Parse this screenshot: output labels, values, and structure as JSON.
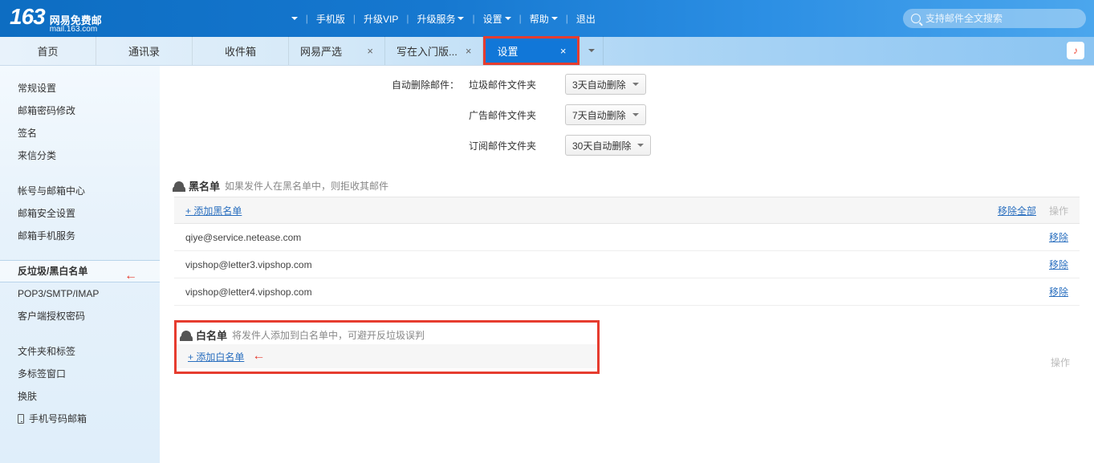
{
  "header": {
    "logo_num": "163",
    "logo_cn": "网易免费邮",
    "logo_en": "mail.163.com",
    "nav": {
      "mobile": "手机版",
      "upgrade_vip": "升级VIP",
      "upgrade_service": "升级服务",
      "settings": "设置",
      "help": "帮助",
      "logout": "退出"
    },
    "search_placeholder": "支持邮件全文搜索"
  },
  "tabs": {
    "home": "首页",
    "contacts": "通讯录",
    "inbox": "收件箱",
    "yanxuan": "网易严选",
    "compose": "写在入门版...",
    "settings": "设置"
  },
  "sidebar": {
    "group1": [
      "常规设置",
      "邮箱密码修改",
      "签名",
      "来信分类"
    ],
    "group2": [
      "帐号与邮箱中心",
      "邮箱安全设置",
      "邮箱手机服务"
    ],
    "active": "反垃圾/黑白名单",
    "group3": [
      "POP3/SMTP/IMAP",
      "客户端授权密码"
    ],
    "group4_item1": "文件夹和标签",
    "group4_item2": "多标签窗口",
    "group4_item3": "换肤",
    "group4_item4": "手机号码邮箱"
  },
  "content": {
    "auto_delete_label": "自动删除邮件：",
    "rows": [
      {
        "folder": "垃圾邮件文件夹",
        "value": "3天自动删除"
      },
      {
        "folder": "广告邮件文件夹",
        "value": "7天自动删除"
      },
      {
        "folder": "订阅邮件文件夹",
        "value": "30天自动删除"
      }
    ],
    "blacklist": {
      "title": "黑名单",
      "desc": "如果发件人在黑名单中，则拒收其邮件",
      "add": "+ 添加黑名单",
      "remove_all": "移除全部",
      "ops": "操作",
      "remove": "移除",
      "items": [
        "qiye@service.netease.com",
        "vipshop@letter3.vipshop.com",
        "vipshop@letter4.vipshop.com"
      ]
    },
    "whitelist": {
      "title": "白名单",
      "desc": "将发件人添加到白名单中，可避开反垃圾误判",
      "add": "+ 添加白名单",
      "ops": "操作"
    }
  }
}
